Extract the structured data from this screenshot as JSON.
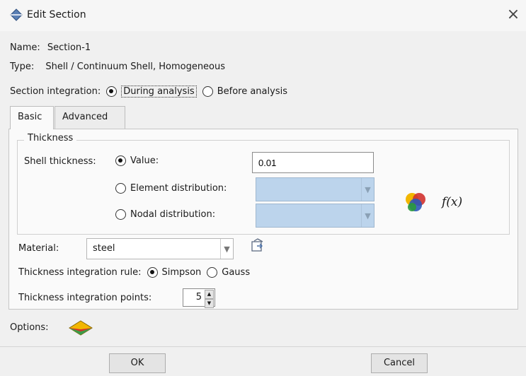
{
  "window": {
    "title": "Edit Section",
    "close_label": "×"
  },
  "info": {
    "name_label": "Name:",
    "name_value": "Section-1",
    "type_label": "Type:",
    "type_value": "Shell / Continuum Shell, Homogeneous"
  },
  "section_integration": {
    "label": "Section integration:",
    "option_during": "During analysis",
    "option_before": "Before analysis",
    "selected": "During analysis"
  },
  "tabs": [
    {
      "label": "Basic",
      "active": true
    },
    {
      "label": "Advanced",
      "active": false
    }
  ],
  "thickness": {
    "group_label": "Thickness",
    "shell_label": "Shell thickness:",
    "value_option": "Value:",
    "value": "0.01",
    "element_distribution": "Element distribution:",
    "nodal_distribution": "Nodal distribution:",
    "fx_label": "f(x)"
  },
  "material": {
    "label": "Material:",
    "value": "steel"
  },
  "integration_rule": {
    "label": "Thickness integration rule:",
    "option_simpson": "Simpson",
    "option_gauss": "Gauss",
    "selected": "Simpson"
  },
  "integration_points": {
    "label": "Thickness integration points:",
    "value": "5"
  },
  "options": {
    "label": "Options:"
  },
  "buttons": {
    "ok": "OK",
    "cancel": "Cancel"
  }
}
